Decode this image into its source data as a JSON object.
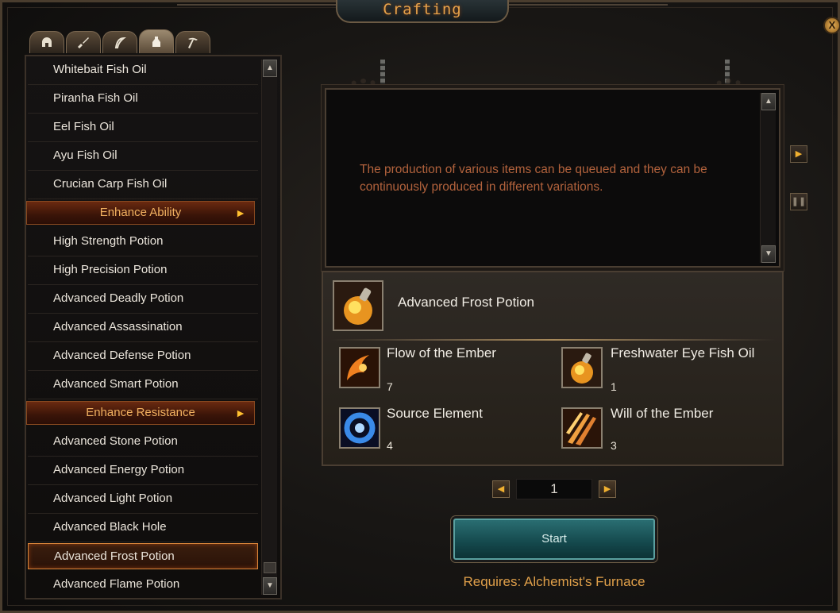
{
  "window": {
    "title": "Crafting",
    "close_label": "X"
  },
  "tabs": [
    {
      "icon": "helmet-icon",
      "active": false
    },
    {
      "icon": "sword-icon",
      "active": false
    },
    {
      "icon": "feather-icon",
      "active": false
    },
    {
      "icon": "potion-bag-icon",
      "active": true
    },
    {
      "icon": "pickaxe-icon",
      "active": false
    }
  ],
  "list": {
    "items_top": [
      "Whitebait Fish Oil",
      "Piranha Fish Oil",
      "Eel Fish Oil",
      "Ayu Fish Oil",
      "Crucian Carp Fish Oil"
    ],
    "category_1": "Enhance Ability",
    "items_mid": [
      "High Strength Potion",
      "High Precision Potion",
      "Advanced Deadly Potion",
      "Advanced Assassination",
      "Advanced Defense Potion",
      "Advanced Smart Potion"
    ],
    "category_2": "Enhance Resistance",
    "items_bottom": [
      "Advanced Stone Potion",
      "Advanced Energy Potion",
      "Advanced Light Potion",
      "Advanced Black Hole",
      "Advanced Frost Potion",
      "Advanced Flame Potion"
    ],
    "selected": "Advanced Frost Potion"
  },
  "description": "The production of various items can be queued and they can be continuously produced in different variations.",
  "recipe": {
    "result_name": "Advanced Frost Potion",
    "ingredients": [
      {
        "name": "Flow of the Ember",
        "qty": "7",
        "icon": "ember-flow-icon"
      },
      {
        "name": "Freshwater Eye Fish Oil",
        "qty": "1",
        "icon": "fish-oil-potion-icon"
      },
      {
        "name": "Source Element",
        "qty": "4",
        "icon": "source-element-icon"
      },
      {
        "name": "Will of the Ember",
        "qty": "3",
        "icon": "ember-will-icon"
      }
    ]
  },
  "quantity": {
    "value": "1"
  },
  "start_label": "Start",
  "requires": "Requires: Alchemist's Furnace"
}
